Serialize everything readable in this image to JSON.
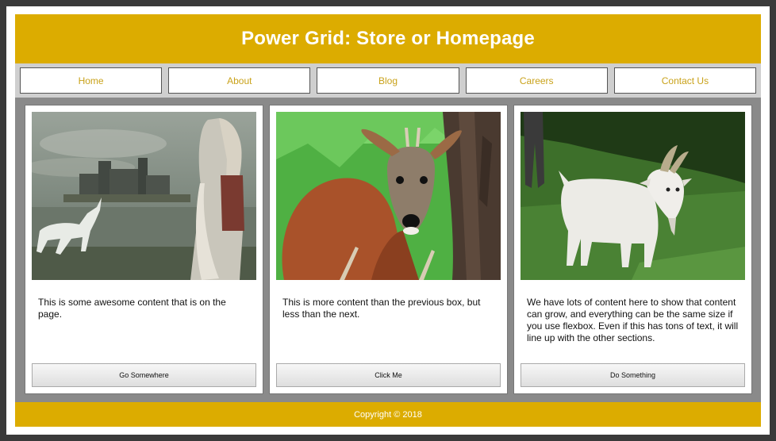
{
  "header": {
    "title": "Power Grid: Store or Homepage"
  },
  "nav": {
    "items": [
      {
        "label": "Home"
      },
      {
        "label": "About"
      },
      {
        "label": "Blog"
      },
      {
        "label": "Careers"
      },
      {
        "label": "Contact Us"
      }
    ]
  },
  "cards": [
    {
      "image": "unicorn-castle-woman-photo",
      "text": "This is some awesome content that is on the page.",
      "button": "Go Somewhere"
    },
    {
      "image": "deer-photo",
      "text": "This is more content than the previous box, but less than the next.",
      "button": "Click Me"
    },
    {
      "image": "goat-photo",
      "text": "We have lots of content here to show that content can grow, and everything can be the same size if you use flexbox. Even if this has tons of text, it will line up with the other sections.",
      "button": "Do Something"
    }
  ],
  "footer": {
    "text": "Copyright © 2018"
  },
  "colors": {
    "accent": "#dcac00",
    "nav_text": "#c9a21a",
    "content_bg": "#8a8a8a"
  }
}
